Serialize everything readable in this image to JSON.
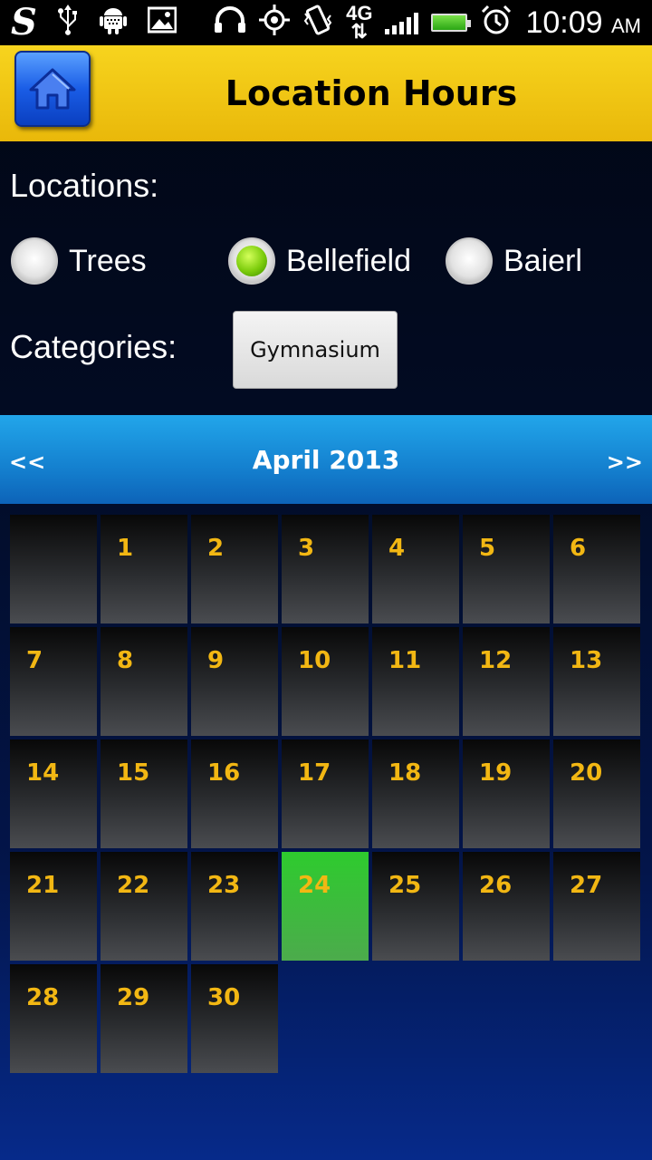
{
  "status_bar": {
    "time": "10:09",
    "ampm": "AM",
    "network": "4G",
    "icons": [
      "s-app-icon",
      "usb-icon",
      "android-debug-icon",
      "image-icon",
      "headphones-icon",
      "gps-icon",
      "vibrate-icon",
      "network-4g-icon",
      "signal-icon",
      "battery-charging-icon",
      "alarm-icon"
    ]
  },
  "header": {
    "title": "Location Hours",
    "home_icon": "home-icon",
    "background_color": "#f3c813"
  },
  "form": {
    "locations_label": "Locations:",
    "locations": [
      {
        "label": "Trees",
        "selected": false
      },
      {
        "label": "Bellefield",
        "selected": true
      },
      {
        "label": "Baierl",
        "selected": false
      }
    ],
    "categories_label": "Categories:",
    "category_value": "Gymnasium"
  },
  "calendar": {
    "prev_label": "<<",
    "next_label": ">>",
    "month_title": "April 2013",
    "leading_blanks": 1,
    "days": [
      "1",
      "2",
      "3",
      "4",
      "5",
      "6",
      "7",
      "8",
      "9",
      "10",
      "11",
      "12",
      "13",
      "14",
      "15",
      "16",
      "17",
      "18",
      "19",
      "20",
      "21",
      "22",
      "23",
      "24",
      "25",
      "26",
      "27",
      "28",
      "29",
      "30"
    ],
    "selected_day": "24",
    "day_number_color": "#f2b713",
    "selected_color": "#35c43a"
  }
}
